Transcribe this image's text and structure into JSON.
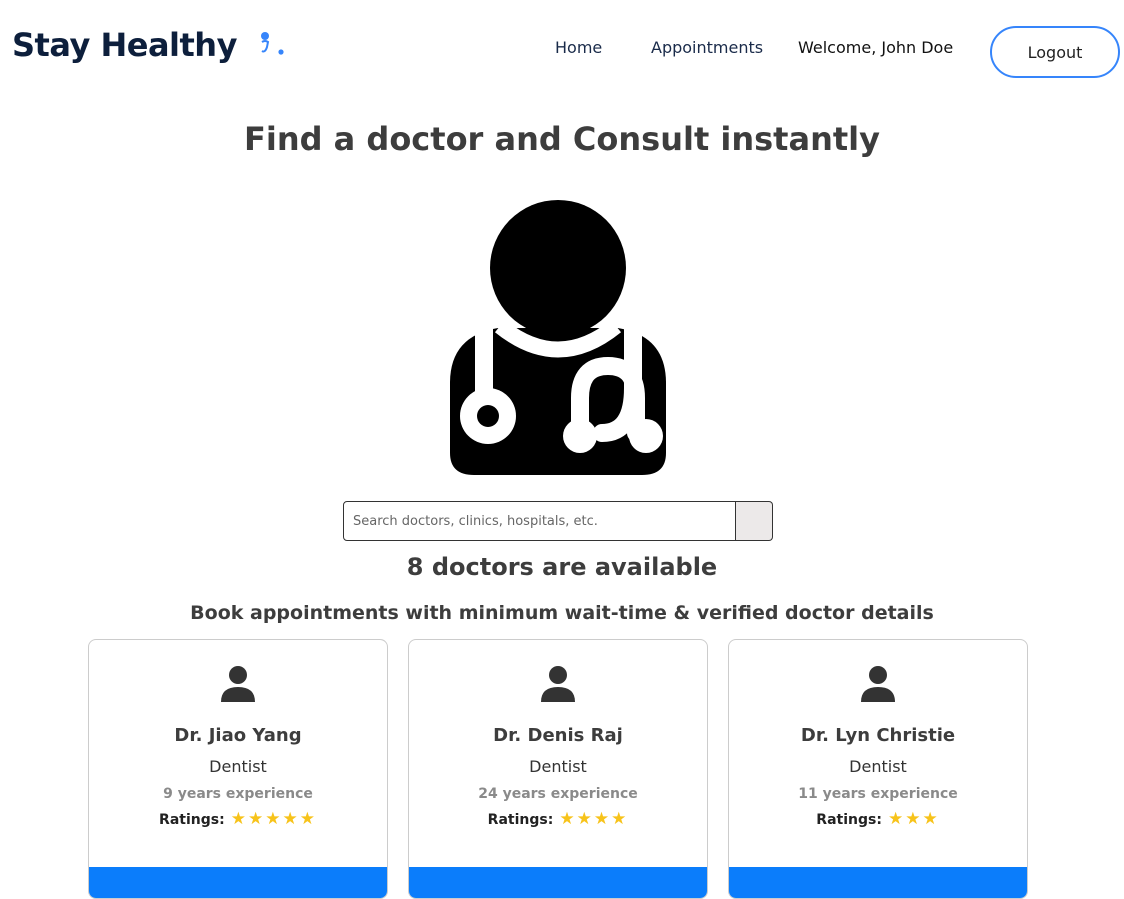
{
  "navbar": {
    "logo_text": "Stay Healthy",
    "home_label": "Home",
    "appointments_label": "Appointments",
    "welcome_text": "Welcome, John Doe",
    "logout_label": "Logout"
  },
  "hero": {
    "title": "Find a doctor and Consult instantly"
  },
  "search": {
    "placeholder": "Search doctors, clinics, hospitals, etc.",
    "value": ""
  },
  "availability_text": "8 doctors are available",
  "subtitle": "Book appointments with minimum wait-time & verified doctor details",
  "ratings_label": "Ratings:",
  "doctors": [
    {
      "name": "Dr. Jiao Yang",
      "speciality": "Dentist",
      "experience": "9 years experience",
      "stars": 5
    },
    {
      "name": "Dr. Denis Raj",
      "speciality": "Dentist",
      "experience": "24 years experience",
      "stars": 4
    },
    {
      "name": "Dr. Lyn Christie",
      "speciality": "Dentist",
      "experience": "11 years experience",
      "stars": 3
    }
  ],
  "colors": {
    "accent": "#3685fb",
    "primary_button": "#0b7dfb",
    "star": "#f7c31a",
    "heading": "#3d3d3d",
    "logo": "#0d1f3c"
  }
}
